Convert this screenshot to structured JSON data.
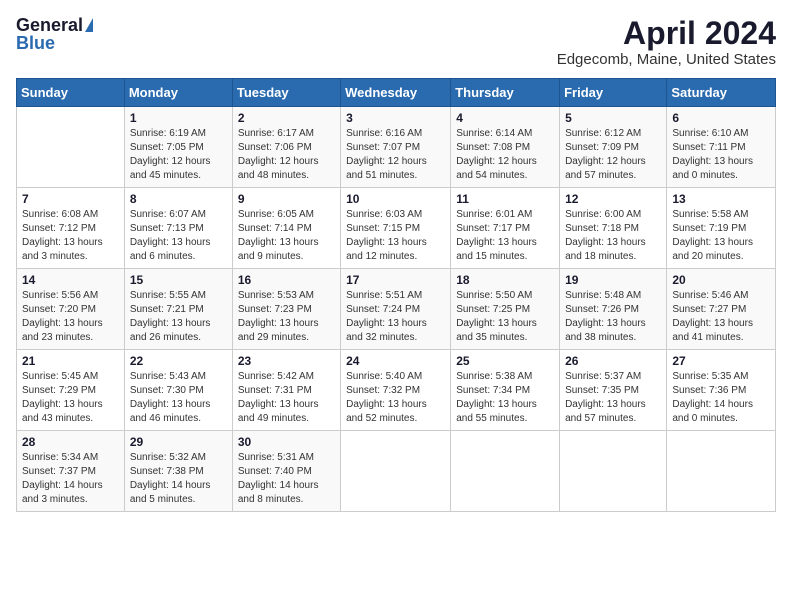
{
  "logo": {
    "general": "General",
    "blue": "Blue"
  },
  "title": "April 2024",
  "location": "Edgecomb, Maine, United States",
  "headers": [
    "Sunday",
    "Monday",
    "Tuesday",
    "Wednesday",
    "Thursday",
    "Friday",
    "Saturday"
  ],
  "weeks": [
    [
      {
        "day": "",
        "info": ""
      },
      {
        "day": "1",
        "info": "Sunrise: 6:19 AM\nSunset: 7:05 PM\nDaylight: 12 hours\nand 45 minutes."
      },
      {
        "day": "2",
        "info": "Sunrise: 6:17 AM\nSunset: 7:06 PM\nDaylight: 12 hours\nand 48 minutes."
      },
      {
        "day": "3",
        "info": "Sunrise: 6:16 AM\nSunset: 7:07 PM\nDaylight: 12 hours\nand 51 minutes."
      },
      {
        "day": "4",
        "info": "Sunrise: 6:14 AM\nSunset: 7:08 PM\nDaylight: 12 hours\nand 54 minutes."
      },
      {
        "day": "5",
        "info": "Sunrise: 6:12 AM\nSunset: 7:09 PM\nDaylight: 12 hours\nand 57 minutes."
      },
      {
        "day": "6",
        "info": "Sunrise: 6:10 AM\nSunset: 7:11 PM\nDaylight: 13 hours\nand 0 minutes."
      }
    ],
    [
      {
        "day": "7",
        "info": "Sunrise: 6:08 AM\nSunset: 7:12 PM\nDaylight: 13 hours\nand 3 minutes."
      },
      {
        "day": "8",
        "info": "Sunrise: 6:07 AM\nSunset: 7:13 PM\nDaylight: 13 hours\nand 6 minutes."
      },
      {
        "day": "9",
        "info": "Sunrise: 6:05 AM\nSunset: 7:14 PM\nDaylight: 13 hours\nand 9 minutes."
      },
      {
        "day": "10",
        "info": "Sunrise: 6:03 AM\nSunset: 7:15 PM\nDaylight: 13 hours\nand 12 minutes."
      },
      {
        "day": "11",
        "info": "Sunrise: 6:01 AM\nSunset: 7:17 PM\nDaylight: 13 hours\nand 15 minutes."
      },
      {
        "day": "12",
        "info": "Sunrise: 6:00 AM\nSunset: 7:18 PM\nDaylight: 13 hours\nand 18 minutes."
      },
      {
        "day": "13",
        "info": "Sunrise: 5:58 AM\nSunset: 7:19 PM\nDaylight: 13 hours\nand 20 minutes."
      }
    ],
    [
      {
        "day": "14",
        "info": "Sunrise: 5:56 AM\nSunset: 7:20 PM\nDaylight: 13 hours\nand 23 minutes."
      },
      {
        "day": "15",
        "info": "Sunrise: 5:55 AM\nSunset: 7:21 PM\nDaylight: 13 hours\nand 26 minutes."
      },
      {
        "day": "16",
        "info": "Sunrise: 5:53 AM\nSunset: 7:23 PM\nDaylight: 13 hours\nand 29 minutes."
      },
      {
        "day": "17",
        "info": "Sunrise: 5:51 AM\nSunset: 7:24 PM\nDaylight: 13 hours\nand 32 minutes."
      },
      {
        "day": "18",
        "info": "Sunrise: 5:50 AM\nSunset: 7:25 PM\nDaylight: 13 hours\nand 35 minutes."
      },
      {
        "day": "19",
        "info": "Sunrise: 5:48 AM\nSunset: 7:26 PM\nDaylight: 13 hours\nand 38 minutes."
      },
      {
        "day": "20",
        "info": "Sunrise: 5:46 AM\nSunset: 7:27 PM\nDaylight: 13 hours\nand 41 minutes."
      }
    ],
    [
      {
        "day": "21",
        "info": "Sunrise: 5:45 AM\nSunset: 7:29 PM\nDaylight: 13 hours\nand 43 minutes."
      },
      {
        "day": "22",
        "info": "Sunrise: 5:43 AM\nSunset: 7:30 PM\nDaylight: 13 hours\nand 46 minutes."
      },
      {
        "day": "23",
        "info": "Sunrise: 5:42 AM\nSunset: 7:31 PM\nDaylight: 13 hours\nand 49 minutes."
      },
      {
        "day": "24",
        "info": "Sunrise: 5:40 AM\nSunset: 7:32 PM\nDaylight: 13 hours\nand 52 minutes."
      },
      {
        "day": "25",
        "info": "Sunrise: 5:38 AM\nSunset: 7:34 PM\nDaylight: 13 hours\nand 55 minutes."
      },
      {
        "day": "26",
        "info": "Sunrise: 5:37 AM\nSunset: 7:35 PM\nDaylight: 13 hours\nand 57 minutes."
      },
      {
        "day": "27",
        "info": "Sunrise: 5:35 AM\nSunset: 7:36 PM\nDaylight: 14 hours\nand 0 minutes."
      }
    ],
    [
      {
        "day": "28",
        "info": "Sunrise: 5:34 AM\nSunset: 7:37 PM\nDaylight: 14 hours\nand 3 minutes."
      },
      {
        "day": "29",
        "info": "Sunrise: 5:32 AM\nSunset: 7:38 PM\nDaylight: 14 hours\nand 5 minutes."
      },
      {
        "day": "30",
        "info": "Sunrise: 5:31 AM\nSunset: 7:40 PM\nDaylight: 14 hours\nand 8 minutes."
      },
      {
        "day": "",
        "info": ""
      },
      {
        "day": "",
        "info": ""
      },
      {
        "day": "",
        "info": ""
      },
      {
        "day": "",
        "info": ""
      }
    ]
  ]
}
